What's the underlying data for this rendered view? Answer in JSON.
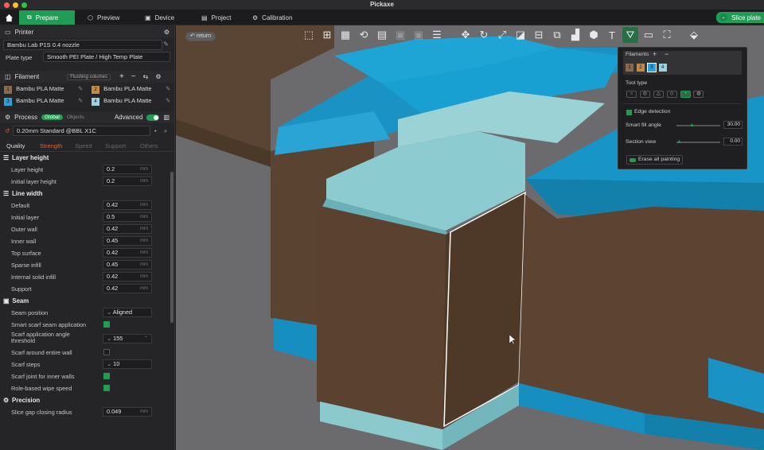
{
  "app": {
    "title": "Pickaxe"
  },
  "colors": {
    "accent": "#1f9d55",
    "brown": "#5b4331",
    "blue": "#1b9acb",
    "teal": "#6bb8bf"
  },
  "nav": {
    "home_icon": "home-icon",
    "tabs": [
      {
        "label": "Prepare",
        "icon": "prepare-icon"
      },
      {
        "label": "Preview",
        "icon": "preview-icon"
      },
      {
        "label": "Device",
        "icon": "device-icon"
      },
      {
        "label": "Project",
        "icon": "project-icon"
      },
      {
        "label": "Calibration",
        "icon": "calibration-icon"
      }
    ],
    "slice_label": "Slice plate"
  },
  "printer": {
    "header": "Printer",
    "name": "Bambu Lab P1S 0.4 nozzle",
    "plate_label": "Plate type",
    "plate_value": "Smooth PEI Plate / High Temp Plate"
  },
  "filament": {
    "header": "Filament",
    "flushing": "Flushing volumes",
    "slots": [
      {
        "num": "1",
        "name": "Bambu PLA Matte",
        "color": "#8a6a4f"
      },
      {
        "num": "2",
        "name": "Bambu PLA Matte",
        "color": "#c08a4a"
      },
      {
        "num": "3",
        "name": "Bambu PLA Matte",
        "color": "#2aa2d6"
      },
      {
        "num": "4",
        "name": "Bambu PLA Matte",
        "color": "#9bd4de"
      }
    ]
  },
  "process": {
    "header": "Process",
    "global": "Global",
    "objects": "Objects",
    "advanced": "Advanced",
    "preset": "0.20mm Standard @BBL X1C",
    "tabs": [
      "Quality",
      "Strength",
      "Speed",
      "Support",
      "Others"
    ]
  },
  "settings": {
    "layer_height": {
      "title": "Layer height",
      "rows": [
        {
          "label": "Layer height",
          "value": "0.2",
          "unit": "mm"
        },
        {
          "label": "Initial layer height",
          "value": "0.2",
          "unit": "mm"
        }
      ]
    },
    "line_width": {
      "title": "Line width",
      "rows": [
        {
          "label": "Default",
          "value": "0.42",
          "unit": "mm"
        },
        {
          "label": "Initial layer",
          "value": "0.5",
          "unit": "mm"
        },
        {
          "label": "Outer wall",
          "value": "0.42",
          "unit": "mm"
        },
        {
          "label": "Inner wall",
          "value": "0.45",
          "unit": "mm"
        },
        {
          "label": "Top surface",
          "value": "0.42",
          "unit": "mm"
        },
        {
          "label": "Sparse infill",
          "value": "0.45",
          "unit": "mm"
        },
        {
          "label": "Internal solid infill",
          "value": "0.42",
          "unit": "mm"
        },
        {
          "label": "Support",
          "value": "0.42",
          "unit": "mm"
        }
      ]
    },
    "seam": {
      "title": "Seam",
      "position_label": "Seam position",
      "position_value": "Aligned",
      "smart_scarf_label": "Smart scarf seam application",
      "angle_label_1": "Scarf application angle",
      "angle_label_2": "threshold",
      "angle_value": "155",
      "around_label": "Scarf around entire wall",
      "steps_label": "Scarf steps",
      "steps_value": "10",
      "inner_label": "Scarf joint for inner walls",
      "wipe_label": "Role-based wipe speed"
    },
    "precision": {
      "title": "Precision",
      "gap_label": "Slice gap closing radius",
      "gap_value": "0.049",
      "gap_unit": "mm"
    }
  },
  "viewport": {
    "return_label": "return",
    "toolbar_icons": [
      "add-cube-icon",
      "add-plate-icon",
      "arrange-icon",
      "orient-icon",
      "layout-icon",
      "split-objects-icon",
      "split-parts-icon",
      "layers-icon",
      "move-icon",
      "rotate-icon",
      "scale-icon",
      "lay-on-face-icon",
      "cut-icon",
      "mesh-boolean-icon",
      "support-paint-icon",
      "seam-paint-icon",
      "text-icon",
      "color-paint-icon",
      "measure-icon",
      "assembly-icon",
      "view-icon"
    ]
  },
  "paint_panel": {
    "filaments_label": "Filaments",
    "swatches": [
      {
        "num": "1",
        "color": "#8a6a4f"
      },
      {
        "num": "2",
        "color": "#c08a4a"
      },
      {
        "num": "3",
        "color": "#2aa2d6"
      },
      {
        "num": "4",
        "color": "#9bd4de"
      }
    ],
    "tool_type_label": "Tool type",
    "edge_label": "Edge detection",
    "smart_fill_label": "Smart fill angle",
    "smart_fill_value": "30.00",
    "section_label": "Section view",
    "section_value": "0.00",
    "erase_label": "Erase all painting"
  }
}
